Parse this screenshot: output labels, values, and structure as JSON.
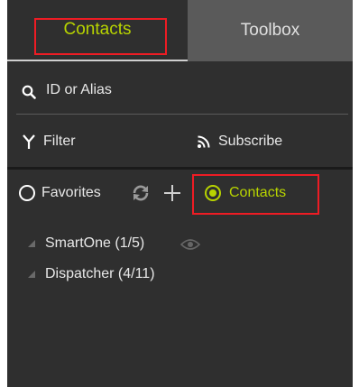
{
  "tabs": {
    "contacts": "Contacts",
    "toolbox": "Toolbox"
  },
  "search": {
    "placeholder": "ID or Alias"
  },
  "toolbar": {
    "filter": "Filter",
    "subscribe": "Subscribe"
  },
  "mode": {
    "favorites": "Favorites",
    "contacts": "Contacts",
    "selected": "contacts"
  },
  "groups": [
    {
      "name": "SmartOne (1/5)",
      "has_eye": true
    },
    {
      "name": "Dispatcher (4/11)",
      "has_eye": false
    }
  ],
  "colors": {
    "accent": "#b8d400",
    "highlight": "#ee1c24",
    "panel": "#2f2f2f",
    "tab_inactive": "#5a5a5a"
  }
}
